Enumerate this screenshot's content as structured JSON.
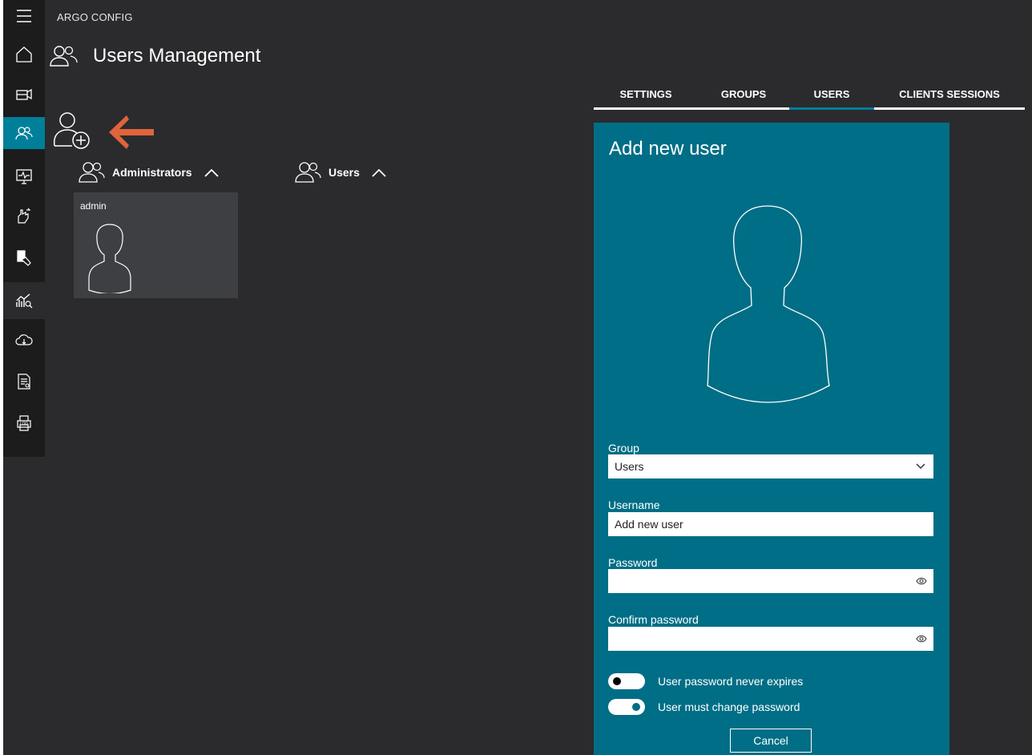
{
  "app": {
    "title": "ARGO CONFIG"
  },
  "page": {
    "title": "Users Management"
  },
  "sidebar": {
    "items": [
      {
        "icon": "hamburger-menu-icon"
      },
      {
        "icon": "home-icon"
      },
      {
        "icon": "camera-device-icon"
      },
      {
        "icon": "users-icon",
        "active": true
      },
      {
        "icon": "monitor-activity-icon"
      },
      {
        "icon": "hand-gesture-icon"
      },
      {
        "icon": "device-hand-icon"
      },
      {
        "icon": "analytics-search-icon"
      },
      {
        "icon": "cloud-icon"
      },
      {
        "icon": "document-search-icon"
      },
      {
        "icon": "log-printer-icon"
      }
    ]
  },
  "groups": {
    "administrators": {
      "label": "Administrators"
    },
    "users": {
      "label": "Users"
    }
  },
  "user_cards": [
    {
      "name": "admin"
    }
  ],
  "tabs": [
    {
      "label": "SETTINGS",
      "active": false
    },
    {
      "label": "GROUPS",
      "active": false
    },
    {
      "label": "USERS",
      "active": true
    },
    {
      "label": "CLIENTS SESSIONS",
      "active": false
    }
  ],
  "form": {
    "title": "Add new user",
    "group_label": "Group",
    "group_value": "Users",
    "username_label": "Username",
    "username_value": "Add new user",
    "password_label": "Password",
    "password_value": "",
    "confirm_label": "Confirm password",
    "confirm_value": "",
    "toggle_never_expires": {
      "label": "User password never expires",
      "on": false
    },
    "toggle_must_change": {
      "label": "User must change password",
      "on": true
    },
    "cancel_label": "Cancel"
  },
  "colors": {
    "accent": "#007f9a",
    "panel": "#006e86",
    "background": "#2b2b2d",
    "arrow": "#e0643c"
  }
}
